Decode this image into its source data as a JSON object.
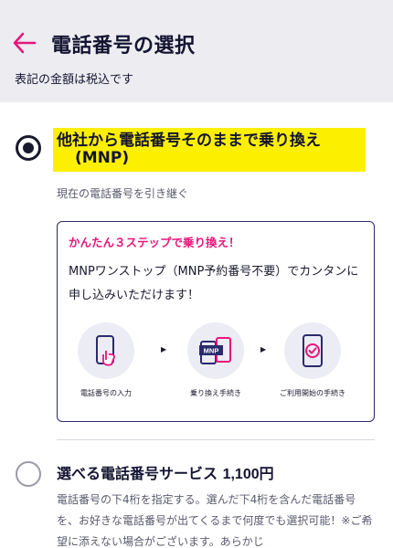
{
  "header": {
    "title": "電話番号の選択",
    "tax_note": "表記の金額は税込です",
    "accent_color": "#e6167a"
  },
  "options": {
    "mnp": {
      "selected": true,
      "title_line1": "他社から電話番号そのままで乗り換え",
      "title_line2": "(MNP)",
      "subtitle": "現在の電話番号を引き継ぐ",
      "highlight_color": "#fcf000",
      "card": {
        "heading": "かんたん３ステップで乗り換え！",
        "body": "MNPワンストップ（MNP予約番号不要）でカンタンに申し込みいただけます！",
        "steps": [
          {
            "icon": "phone-tap-icon",
            "label": "電話番号の入力"
          },
          {
            "icon": "mnp-transfer-icon",
            "label": "乗り換え手続き"
          },
          {
            "icon": "phone-check-icon",
            "label": "ご利用開始の手続き"
          }
        ],
        "arrow_glyph": "▶"
      }
    },
    "select_number": {
      "selected": false,
      "title": "選べる電話番号サービス ",
      "price": "1,100円",
      "description": "電話番号の下4桁を指定する。選んだ下4桁を含んだ電話番号を、お好きな電話番号が出てくるまで何度でも選択可能！※ご希望に添えない場合がございます。あらかじ"
    }
  }
}
